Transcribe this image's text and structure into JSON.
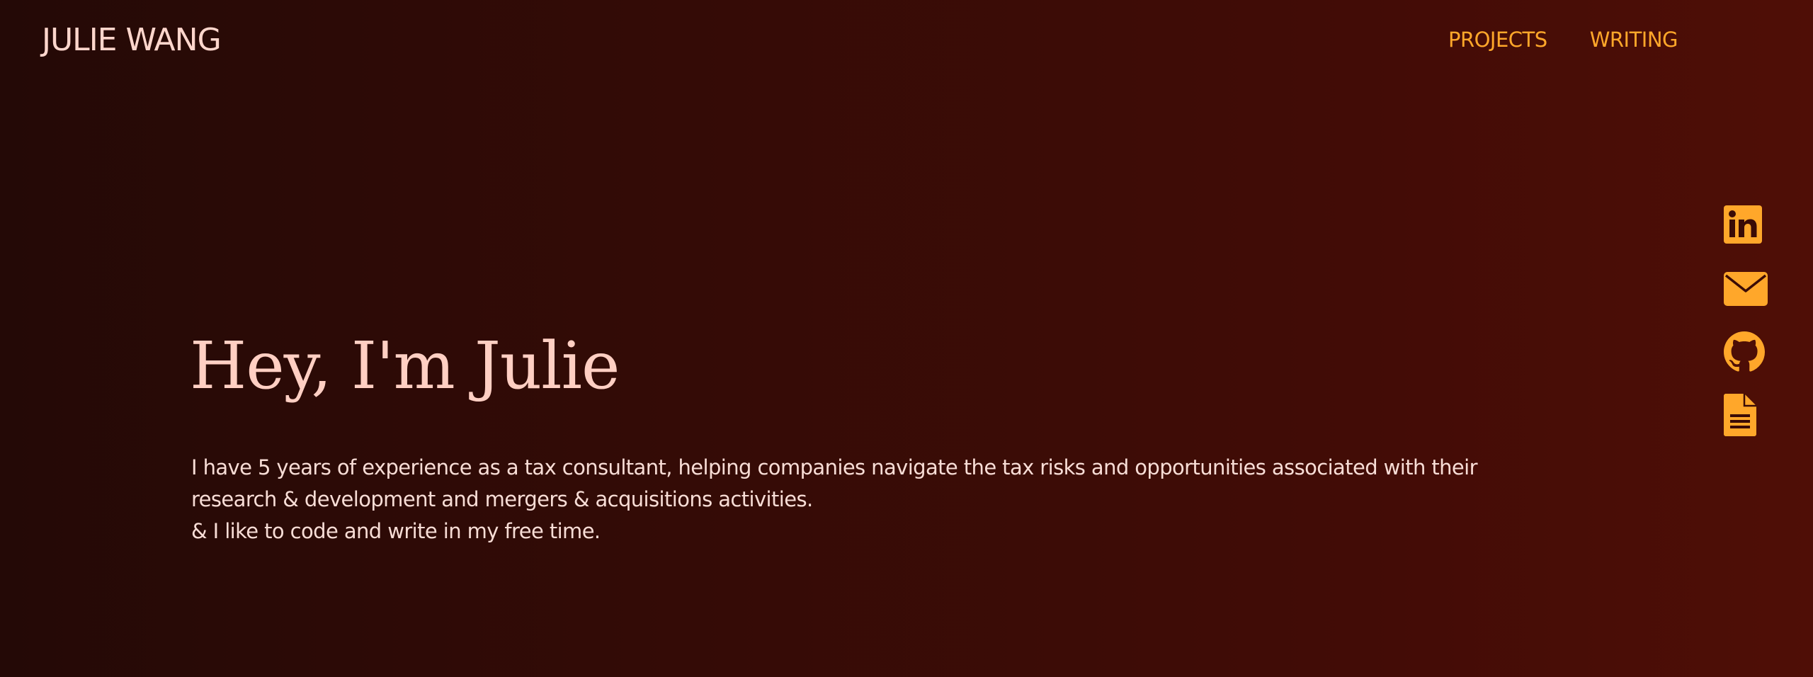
{
  "header": {
    "site_name": "JULIE WANG",
    "nav": [
      {
        "label": "PROJECTS"
      },
      {
        "label": "WRITING"
      }
    ]
  },
  "hero": {
    "title": "Hey, I'm Julie",
    "bio_lines": [
      "I have 5 years of experience as a tax consultant, helping companies navigate the tax risks and opportunities associated with their",
      "research & development and mergers & acquisitions activities.",
      "& I like to code and write in my free time."
    ]
  },
  "social_links": [
    {
      "icon": "linkedin-icon"
    },
    {
      "icon": "mail-icon"
    },
    {
      "icon": "github-icon"
    },
    {
      "icon": "document-icon"
    }
  ],
  "colors": {
    "background_start": "#240906",
    "background_end": "#4f0e06",
    "accent": "#ffa72a",
    "title_text": "#ffcfc3",
    "body_text": "#f8ddd6"
  }
}
